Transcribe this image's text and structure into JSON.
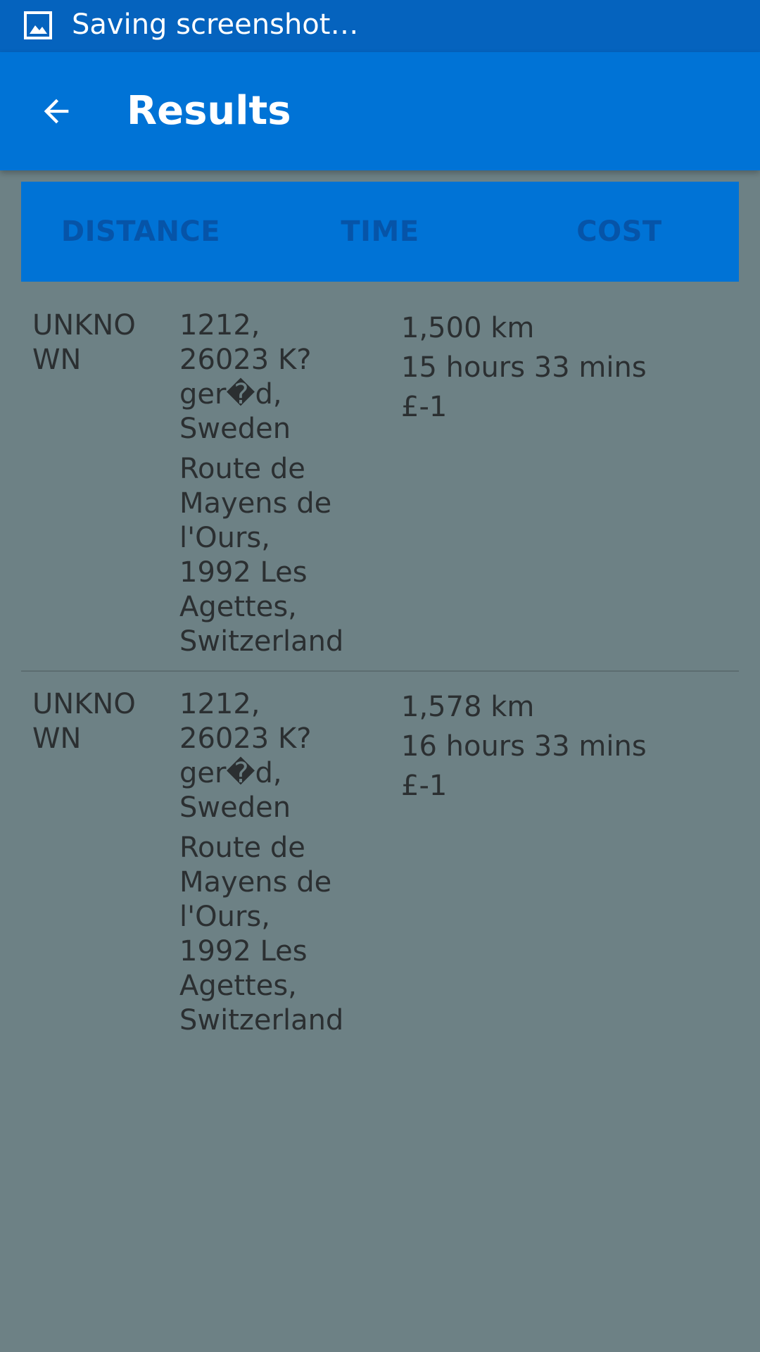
{
  "status_bar": {
    "text": "Saving screenshot…"
  },
  "app_bar": {
    "title": "Results"
  },
  "tabs": [
    {
      "label": "DISTANCE"
    },
    {
      "label": "TIME"
    },
    {
      "label": "COST"
    }
  ],
  "results": [
    {
      "status": "UNKNOWN",
      "from": "1212, 26023 K?ger�d, Sweden",
      "to": "Route de Mayens de l'Ours, 1992 Les Agettes, Switzerland",
      "distance": "1,500 km",
      "time": "15 hours 33 mins",
      "cost": "£-1"
    },
    {
      "status": "UNKNOWN",
      "from": "1212, 26023 K?ger�d, Sweden",
      "to": "Route de Mayens de l'Ours, 1992 Les Agettes, Switzerland",
      "distance": "1,578 km",
      "time": "16 hours 33 mins",
      "cost": "£-1"
    }
  ],
  "colors": {
    "status_bar": "#0563be",
    "app_bar": "#0073d6",
    "background": "#6d8185",
    "tab_text": "#0654a8"
  }
}
